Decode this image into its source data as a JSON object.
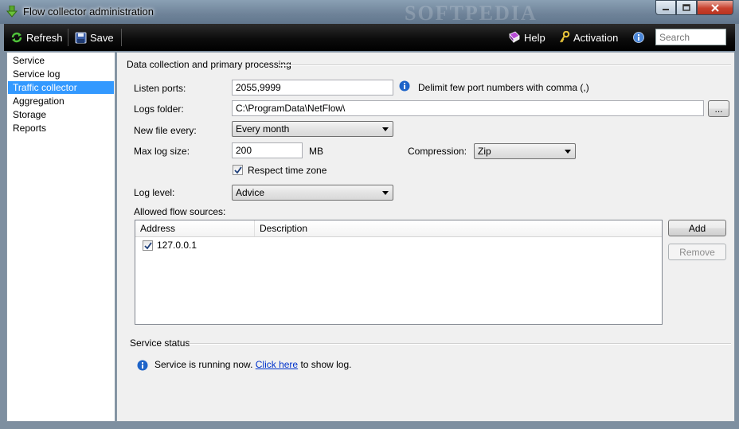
{
  "window": {
    "title": "Flow collector administration",
    "watermark": "SOFTPEDIA"
  },
  "toolbar": {
    "refresh_label": "Refresh",
    "save_label": "Save",
    "help_label": "Help",
    "activation_label": "Activation",
    "search_placeholder": "Search"
  },
  "sidebar": {
    "items": [
      {
        "label": "Service"
      },
      {
        "label": "Service log"
      },
      {
        "label": "Traffic collector"
      },
      {
        "label": "Aggregation"
      },
      {
        "label": "Storage"
      },
      {
        "label": "Reports"
      }
    ],
    "selected": "Traffic collector"
  },
  "collection": {
    "group_title": "Data collection and primary processing",
    "listen_ports_label": "Listen ports:",
    "listen_ports_value": "2055,9999",
    "listen_ports_hint": "Delimit few port numbers with comma (,)",
    "logs_folder_label": "Logs folder:",
    "logs_folder_value": "C:\\ProgramData\\NetFlow\\",
    "browse_label": "...",
    "new_file_label": "New file every:",
    "new_file_value": "Every month",
    "max_log_label": "Max log size:",
    "max_log_value": "200",
    "max_log_unit": "MB",
    "compression_label": "Compression:",
    "compression_value": "Zip",
    "respect_tz_label": "Respect time zone",
    "respect_tz_checked": true,
    "log_level_label": "Log level:",
    "log_level_value": "Advice",
    "allowed_sources_label": "Allowed flow sources:",
    "columns": [
      "Address",
      "Description"
    ],
    "rows": [
      {
        "address": "127.0.0.1",
        "description": "",
        "checked": true
      }
    ],
    "add_label": "Add",
    "remove_label": "Remove"
  },
  "status": {
    "group_title": "Service status",
    "message_prefix": "Service is running now.",
    "link_text": "Click here",
    "message_suffix": "to show log."
  },
  "colors": {
    "selection": "#3399ff",
    "link": "#0033cc",
    "toolbar_bg": "#000000",
    "info_blue": "#1d63c8"
  }
}
